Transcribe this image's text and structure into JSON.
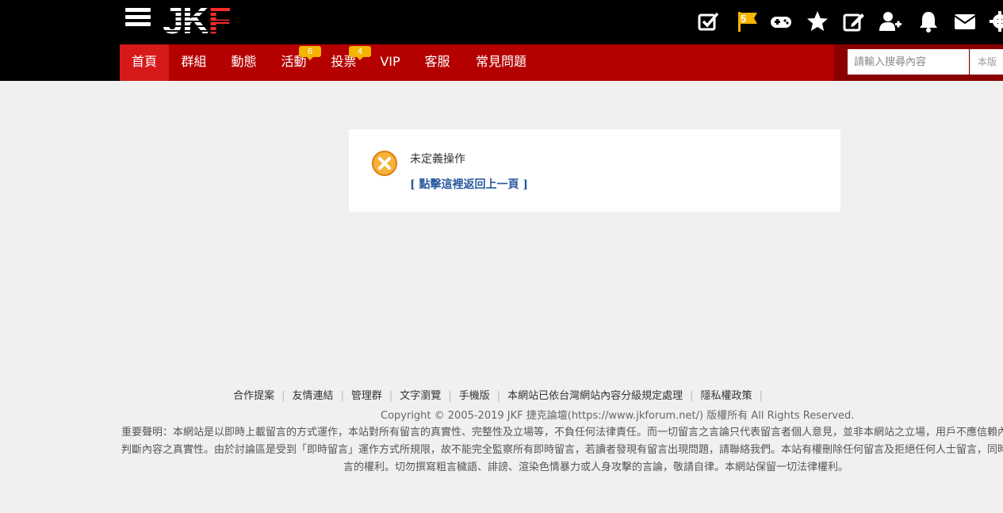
{
  "header": {
    "logo_text_white": "JK",
    "logo_text_red": "F",
    "flag_count": "5",
    "icons": [
      "menu-icon",
      "check-icon",
      "flag-icon",
      "gamepad-icon",
      "star-icon",
      "edit-icon",
      "add-user-icon",
      "bell-icon",
      "mail-icon",
      "gear-icon"
    ]
  },
  "nav": {
    "items": [
      {
        "label": "首頁"
      },
      {
        "label": "群組"
      },
      {
        "label": "動態"
      },
      {
        "label": "活動",
        "badge": "6"
      },
      {
        "label": "投票",
        "badge": "4"
      },
      {
        "label": "VIP"
      },
      {
        "label": "客服"
      },
      {
        "label": "常見問題"
      }
    ]
  },
  "search": {
    "placeholder": "請輸入搜尋內容",
    "scope": "本版"
  },
  "message": {
    "text": "未定義操作",
    "back_link": "[ 點擊這裡返回上一頁 ]"
  },
  "footer": {
    "links": [
      "合作提案",
      "友情連結",
      "管理群",
      "文字瀏覽",
      "手機版",
      "本網站已依台灣網站內容分級規定處理",
      "隱私權政策"
    ],
    "copyright": "Copyright © 2005-2019 JKF 捷克論壇(https://www.jkforum.net/) 版權所有 All Rights Reserved.",
    "disclaimer_1": "重要聲明：本網站是以即時上載留言的方式運作，本站對所有留言的真實性、完整性及立場等，不負任何法律責任。而一切留言之言論只代表留言者個人意見，並非本網站之立場，用戶不應信賴內容，並應自行",
    "disclaimer_2": "判斷內容之真實性。由於討論區是受到「即時留言」運作方式所規限，故不能完全監察所有即時留言，若讀者發現有留言出現問題，請聯絡我們。本站有權刪除任何留言及拒絕任何人士留言，同時亦有不刪除留",
    "disclaimer_3": "言的權利。切勿撰寫粗言穢語、誹謗、渲染色情暴力或人身攻擊的言論，敬請自律。本網站保留一切法律權利。"
  },
  "colors": {
    "topbar": "#000000",
    "navbar": "#b50000",
    "nav_active": "#d61a1a",
    "badge": "#f5b400",
    "link": "#2b5aa0",
    "error_icon": "#f39b1f"
  }
}
